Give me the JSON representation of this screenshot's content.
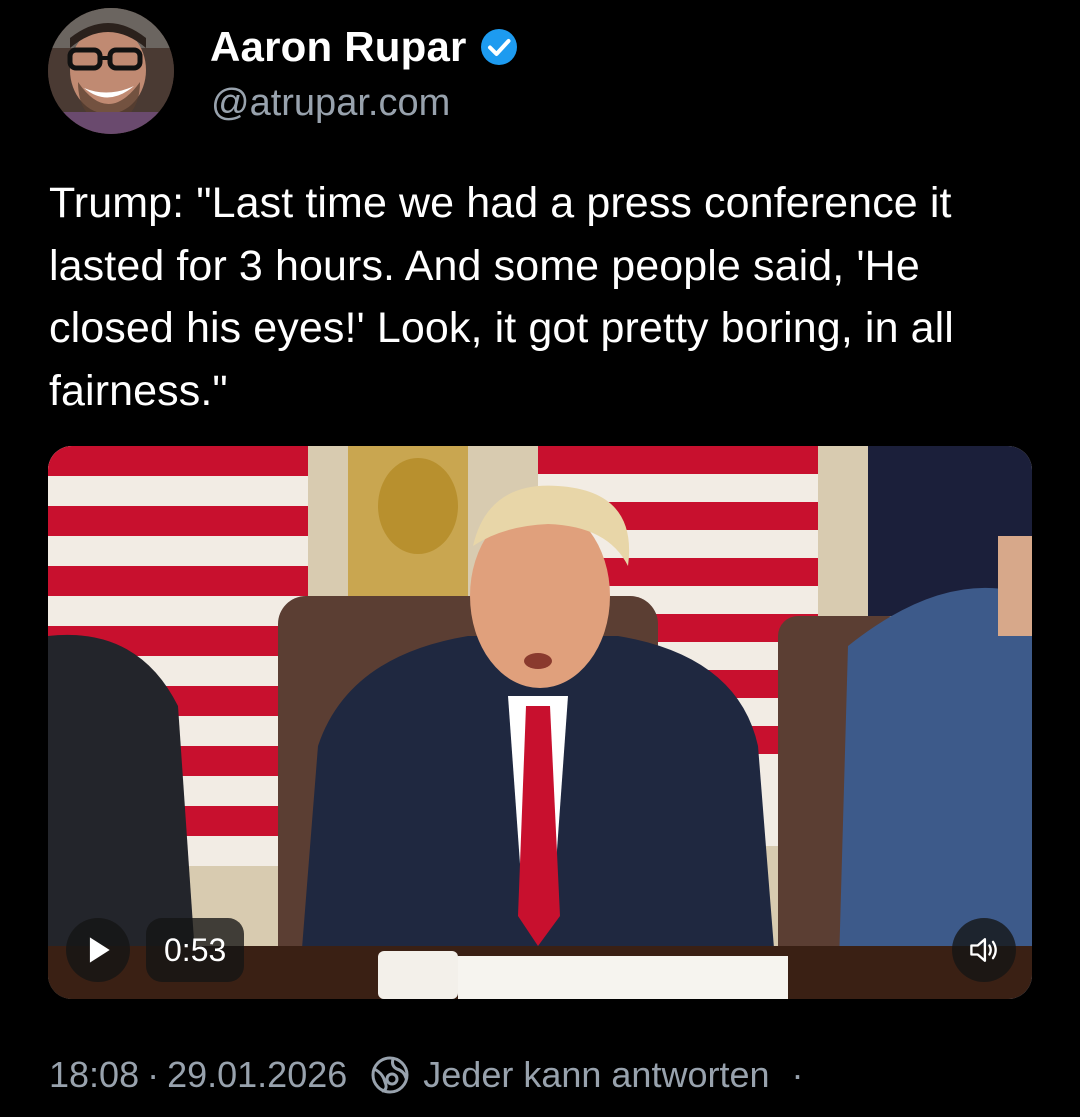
{
  "author": {
    "display_name": "Aaron Rupar",
    "handle": "@atrupar.com",
    "avatar_icon": "avatar-photo",
    "verified_icon": "verified-check-icon",
    "verified_color": "#1d9bf0"
  },
  "post": {
    "text": "Trump: \"Last time we had a press conference it lasted for 3 hours. And some people said, 'He closed his eyes!' Look, it got pretty boring, in all fairness.\""
  },
  "video": {
    "duration": "0:53",
    "play_icon": "play-icon",
    "mute_icon": "speaker-icon"
  },
  "meta": {
    "time": "18:08",
    "separator": "·",
    "date": "29.01.2026",
    "reply_icon": "reply-settings-icon",
    "reply_setting": "Jeder kann antworten",
    "trailing": "·"
  },
  "colors": {
    "background": "#000000",
    "text": "#ffffff",
    "secondary_text": "#98a2ad"
  }
}
